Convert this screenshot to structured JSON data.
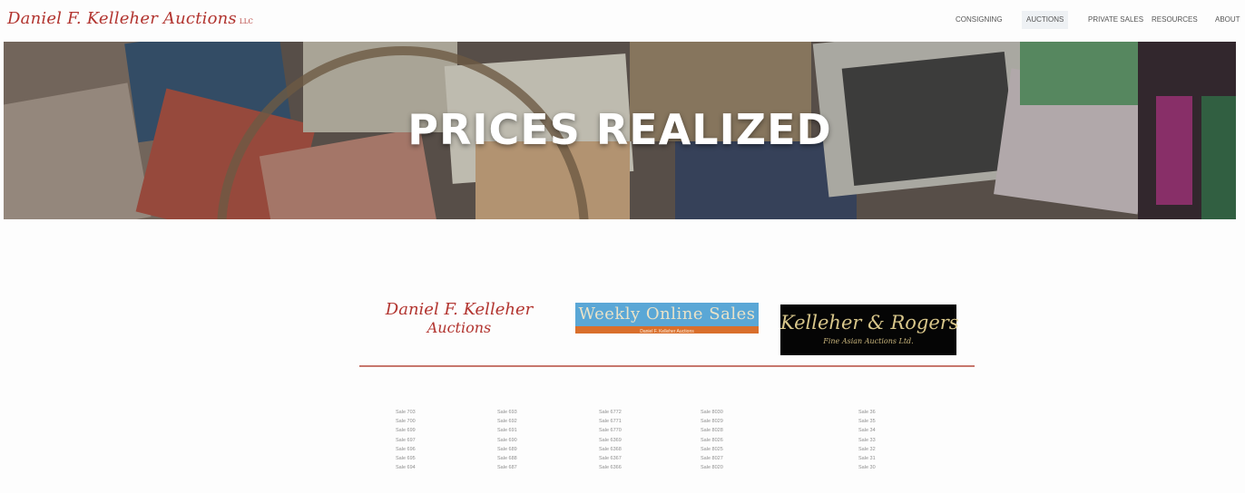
{
  "header": {
    "logo_text": "Daniel F. Kelleher Auctions",
    "logo_suffix": "LLC",
    "nav": [
      {
        "label": "CONSIGNING"
      },
      {
        "label": "AUCTIONS",
        "active": true
      },
      {
        "label": "PRIVATE SALES"
      },
      {
        "label": "RESOURCES"
      },
      {
        "label": "ABOUT"
      }
    ]
  },
  "hero": {
    "title": "PRICES REALIZED"
  },
  "brands": {
    "kelleher": {
      "line1": "Daniel F. Kelleher",
      "line2": "Auctions"
    },
    "weekly": {
      "title": "Weekly Online Sales",
      "subtitle": "Daniel F. Kelleher Auctions"
    },
    "rogers": {
      "title": "Kelleher & Rogers",
      "subtitle": "Fine Asian Auctions Ltd."
    }
  },
  "sales_columns": [
    [
      "Sale 703",
      "Sale 700",
      "Sale 699",
      "Sale 697",
      "Sale 696",
      "Sale 695",
      "Sale 694"
    ],
    [
      "Sale 693",
      "Sale 692",
      "Sale 691",
      "Sale 690",
      "Sale 689",
      "Sale 688",
      "Sale 687"
    ],
    [
      "Sale 6772",
      "Sale 6771",
      "Sale 6770",
      "Sale 6369",
      "Sale 6368",
      "Sale 6367",
      "Sale 6366"
    ],
    [
      "Sale 8030",
      "Sale 8029",
      "Sale 8028",
      "Sale 8026",
      "Sale 8025",
      "Sale 8027",
      "Sale 8020"
    ],
    [
      "Sale 36",
      "Sale 35",
      "Sale 34",
      "Sale 33",
      "Sale 32",
      "Sale 31",
      "Sale 30"
    ]
  ],
  "colors": {
    "brand_red": "#b2342f",
    "divider": "#c7776d",
    "weekly_blue": "#5aa7d6",
    "weekly_orange": "#d96f2c"
  }
}
